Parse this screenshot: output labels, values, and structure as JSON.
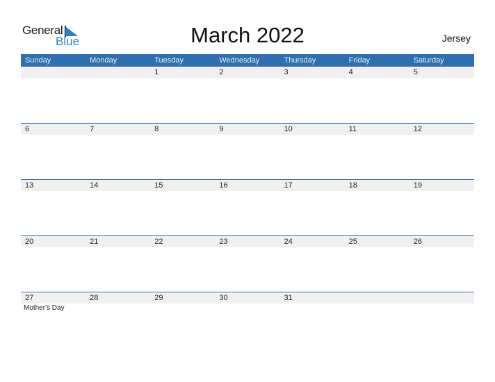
{
  "logo": {
    "text1": "General",
    "text2": "Blue"
  },
  "title": "March 2022",
  "country": "Jersey",
  "weekdays": [
    "Sunday",
    "Monday",
    "Tuesday",
    "Wednesday",
    "Thursday",
    "Friday",
    "Saturday"
  ],
  "weeks": [
    {
      "days": [
        "",
        "",
        "1",
        "2",
        "3",
        "4",
        "5"
      ],
      "events": [
        "",
        "",
        "",
        "",
        "",
        "",
        ""
      ]
    },
    {
      "days": [
        "6",
        "7",
        "8",
        "9",
        "10",
        "11",
        "12"
      ],
      "events": [
        "",
        "",
        "",
        "",
        "",
        "",
        ""
      ]
    },
    {
      "days": [
        "13",
        "14",
        "15",
        "16",
        "17",
        "18",
        "19"
      ],
      "events": [
        "",
        "",
        "",
        "",
        "",
        "",
        ""
      ]
    },
    {
      "days": [
        "20",
        "21",
        "22",
        "23",
        "24",
        "25",
        "26"
      ],
      "events": [
        "",
        "",
        "",
        "",
        "",
        "",
        ""
      ]
    },
    {
      "days": [
        "27",
        "28",
        "29",
        "30",
        "31",
        "",
        ""
      ],
      "events": [
        "Mother's Day",
        "",
        "",
        "",
        "",
        "",
        ""
      ]
    }
  ],
  "colors": {
    "header": "#2e6fb0",
    "brand_blue": "#2a7fc9",
    "row_bg": "#f0f0f0"
  }
}
